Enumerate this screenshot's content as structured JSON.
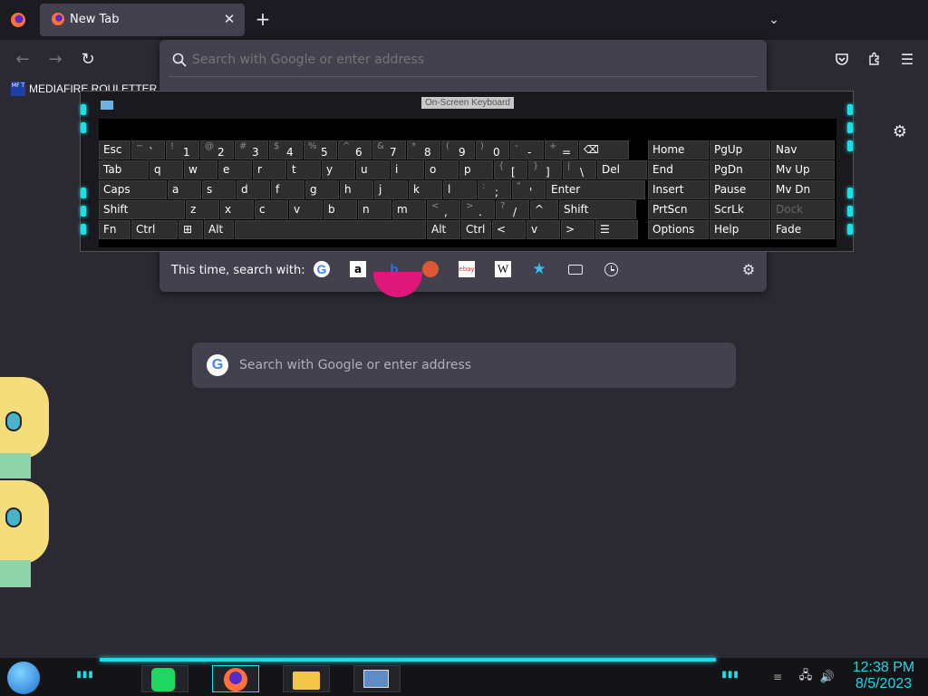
{
  "browser": {
    "tab_title": "New Tab",
    "url_placeholder": "Search with Google or enter address",
    "bookmark_label": "MEDIAFIRE ROULETTER",
    "bookmark_icon_text": "MF T"
  },
  "url_popup": {
    "search_with_label": "This time, search with:",
    "engines": [
      "google-icon",
      "amazon-icon",
      "bing-icon",
      "duckduckgo-icon",
      "ebay-icon",
      "wikipedia-icon",
      "bookmarks-star-icon",
      "tabs-icon",
      "history-icon"
    ]
  },
  "newtab": {
    "search_placeholder": "Search with Google or enter address"
  },
  "keyboard": {
    "title": "On-Screen Keyboard",
    "row1": [
      {
        "main": "Esc"
      },
      {
        "shift": "~",
        "main": "`"
      },
      {
        "shift": "!",
        "main": "1"
      },
      {
        "shift": "@",
        "main": "2"
      },
      {
        "shift": "#",
        "main": "3"
      },
      {
        "shift": "$",
        "main": "4"
      },
      {
        "shift": "%",
        "main": "5"
      },
      {
        "shift": "^",
        "main": "6"
      },
      {
        "shift": "&",
        "main": "7"
      },
      {
        "shift": "*",
        "main": "8"
      },
      {
        "shift": "(",
        "main": "9"
      },
      {
        "shift": ")",
        "main": "0"
      },
      {
        "shift": "-",
        "main": "-"
      },
      {
        "shift": "+",
        "main": "="
      },
      {
        "main": "⌫"
      }
    ],
    "row2": [
      {
        "main": "Tab"
      },
      {
        "main": "q"
      },
      {
        "main": "w"
      },
      {
        "main": "e"
      },
      {
        "main": "r"
      },
      {
        "main": "t"
      },
      {
        "main": "y"
      },
      {
        "main": "u"
      },
      {
        "main": "i"
      },
      {
        "main": "o"
      },
      {
        "main": "p"
      },
      {
        "shift": "{",
        "main": "["
      },
      {
        "shift": "}",
        "main": "]"
      },
      {
        "shift": "|",
        "main": "\\"
      },
      {
        "main": "Del"
      }
    ],
    "row3": [
      {
        "main": "Caps"
      },
      {
        "main": "a"
      },
      {
        "main": "s"
      },
      {
        "main": "d"
      },
      {
        "main": "f"
      },
      {
        "main": "g"
      },
      {
        "main": "h"
      },
      {
        "main": "j"
      },
      {
        "main": "k"
      },
      {
        "main": "l"
      },
      {
        "shift": ":",
        "main": ";"
      },
      {
        "shift": "\"",
        "main": "'"
      },
      {
        "main": "Enter"
      }
    ],
    "row4": [
      {
        "main": "Shift"
      },
      {
        "main": "z"
      },
      {
        "main": "x"
      },
      {
        "main": "c"
      },
      {
        "main": "v"
      },
      {
        "main": "b"
      },
      {
        "main": "n"
      },
      {
        "main": "m"
      },
      {
        "shift": "<",
        "main": ","
      },
      {
        "shift": ">",
        "main": "."
      },
      {
        "shift": "?",
        "main": "/"
      },
      {
        "main": "^"
      },
      {
        "main": "Shift"
      }
    ],
    "row5": [
      {
        "main": "Fn"
      },
      {
        "main": "Ctrl"
      },
      {
        "main": "⊞"
      },
      {
        "main": "Alt"
      },
      {
        "main": ""
      },
      {
        "main": "Alt"
      },
      {
        "main": "Ctrl"
      },
      {
        "main": "<"
      },
      {
        "main": "v"
      },
      {
        "main": ">"
      },
      {
        "main": "☰"
      }
    ],
    "nav": [
      [
        "Home",
        "PgUp",
        "Nav"
      ],
      [
        "End",
        "PgDn",
        "Mv Up"
      ],
      [
        "Insert",
        "Pause",
        "Mv Dn"
      ],
      [
        "PrtScn",
        "ScrLk",
        "Dock"
      ],
      [
        "Options",
        "Help",
        "Fade"
      ]
    ]
  },
  "taskbar": {
    "time": "12:38 PM",
    "date": "8/5/2023"
  },
  "colors": {
    "accent": "#19e0e8",
    "pocket_pink": "#e0177a"
  }
}
